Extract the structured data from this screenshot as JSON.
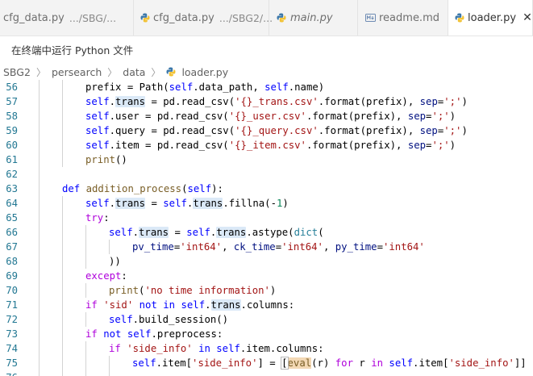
{
  "tabs": [
    {
      "label": "cfg_data.py",
      "path": ".../SBG/...",
      "icon": "python-icon",
      "italic": false,
      "active": false
    },
    {
      "label": "cfg_data.py",
      "path": ".../SBG2/...",
      "icon": "python-icon",
      "italic": false,
      "active": false
    },
    {
      "label": "main.py",
      "path": "",
      "icon": "python-icon",
      "italic": true,
      "active": false
    },
    {
      "label": "readme.md",
      "path": "",
      "icon": "markdown-icon",
      "italic": false,
      "active": false
    },
    {
      "label": "loader.py",
      "path": "",
      "icon": "python-icon",
      "italic": false,
      "active": true
    }
  ],
  "terminal_hint": "在终端中运行 Python 文件",
  "breadcrumb": [
    "SBG2",
    "persearch",
    "data",
    "loader.py"
  ],
  "colors": {
    "python_icon_blue": "#3c78aa",
    "python_icon_yellow": "#f2c233",
    "markdown_icon": "#6d8bb3"
  },
  "code_lines": [
    {
      "n": "56"
    },
    {
      "n": "57"
    },
    {
      "n": "58"
    },
    {
      "n": "59"
    },
    {
      "n": "60"
    },
    {
      "n": "61"
    },
    {
      "n": "62"
    },
    {
      "n": "63"
    },
    {
      "n": "64"
    },
    {
      "n": "65"
    },
    {
      "n": "66"
    },
    {
      "n": "67"
    },
    {
      "n": "68"
    },
    {
      "n": "69"
    },
    {
      "n": "70"
    },
    {
      "n": "71"
    },
    {
      "n": "72"
    },
    {
      "n": "73"
    },
    {
      "n": "74"
    },
    {
      "n": "75"
    },
    {
      "n": "76"
    }
  ],
  "code": {
    "l56": {
      "a": "prefix = Path(",
      "b": "self",
      ".": ".data_path, ",
      "c": "self",
      "d": ".name)"
    },
    "l57": {
      "a": "self",
      ".": ".",
      "b": "trans",
      "c": " = pd.read_csv(",
      "d": "'{}_trans.csv'",
      "e": ".format(prefix), ",
      "f": "sep",
      "g": "=",
      "h": "';'",
      "i": ")"
    },
    "l58": {
      "a": "self",
      "b": ".user = pd.read_csv(",
      "c": "'{}_user.csv'",
      "d": ".format(prefix), ",
      "e": "sep",
      "f": "=",
      "g": "';'",
      "h": ")"
    },
    "l59": {
      "a": "self",
      "b": ".query = pd.read_csv(",
      "c": "'{}_query.csv'",
      "d": ".format(prefix), ",
      "e": "sep",
      "f": "=",
      "g": "';'",
      "h": ")"
    },
    "l60": {
      "a": "self",
      "b": ".item = pd.read_csv(",
      "c": "'{}_item.csv'",
      "d": ".format(prefix), ",
      "e": "sep",
      "f": "=",
      "g": "';'",
      "h": ")"
    },
    "l61": {
      "a": "print",
      "b": "()"
    },
    "l63": {
      "a": "def",
      "b": " ",
      "c": "addition_process",
      "d": "(",
      "e": "self",
      "f": "):"
    },
    "l64": {
      "a": "self",
      "b": ".",
      "c": "trans",
      "d": " = ",
      "e": "self",
      "f": ".",
      "g": "trans",
      "h": ".fillna(-",
      "i": "1",
      "j": ")"
    },
    "l65": {
      "a": "try",
      "b": ":"
    },
    "l66": {
      "a": "self",
      "b": ".",
      "c": "trans",
      "d": " = ",
      "e": "self",
      "f": ".",
      "g": "trans",
      "h": ".astype(",
      "i": "dict",
      "j": "("
    },
    "l67": {
      "a": "pv_time",
      "b": "=",
      "c": "'int64'",
      "d": ", ",
      "e": "ck_time",
      "f": "=",
      "g": "'int64'",
      "h": ", ",
      "i": "py_time",
      "j": "=",
      "k": "'int64'"
    },
    "l68": {
      "a": "))"
    },
    "l69": {
      "a": "except",
      "b": ":"
    },
    "l70": {
      "a": "print",
      "b": "(",
      "c": "'no time information'",
      "d": ")"
    },
    "l71": {
      "a": "if",
      "b": " ",
      "c": "'sid'",
      "d": " ",
      "e": "not in",
      "f": " ",
      "g": "self",
      "h": ".",
      "i": "trans",
      "j": ".columns:"
    },
    "l72": {
      "a": "self",
      "b": ".build_session()"
    },
    "l73": {
      "a": "if",
      "b": " ",
      "c": "not",
      "d": " ",
      "e": "self",
      "f": ".preprocess:"
    },
    "l74": {
      "a": "if",
      "b": " ",
      "c": "'side_info'",
      "d": " ",
      "e": "in",
      "f": " ",
      "g": "self",
      "h": ".item.columns:"
    },
    "l75": {
      "a": "self",
      "b": ".item[",
      "c": "'side_info'",
      "d": "] = ",
      "e": "[",
      "f": "eval",
      "g": "(r) ",
      "h": "for",
      "i": " r ",
      "j": "in",
      "k": " ",
      "l": "self",
      "m": ".item[",
      "n": "'side_info'",
      "o": "]]"
    }
  }
}
